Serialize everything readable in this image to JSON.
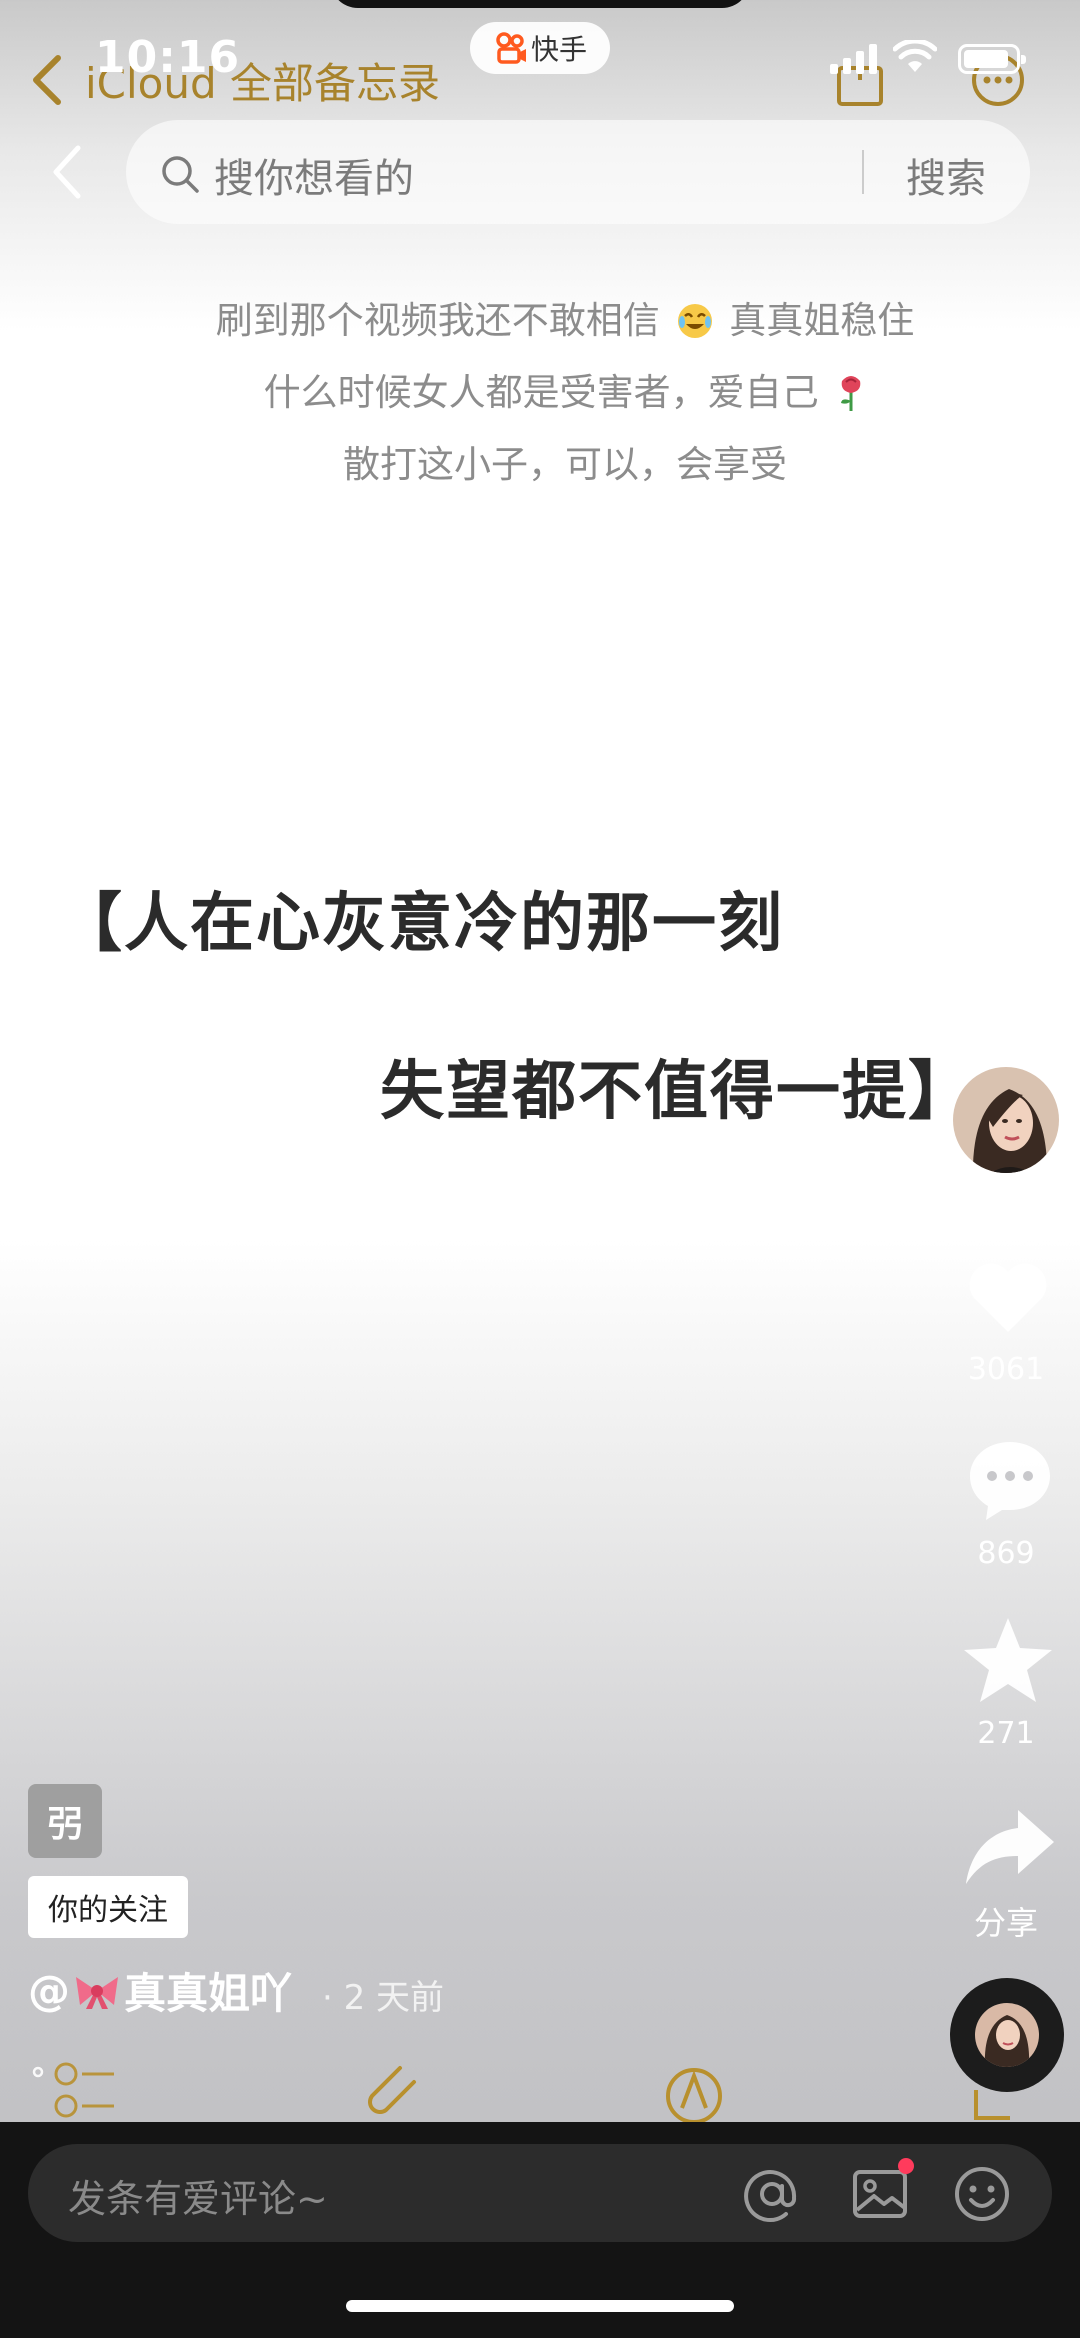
{
  "status_bar": {
    "time": "10:16"
  },
  "notes_app": {
    "back_label": "iCloud 全部备忘录"
  },
  "app_badge": {
    "name": "快手"
  },
  "search": {
    "placeholder": "搜你想看的",
    "button_label": "搜索"
  },
  "caption": {
    "line1_a": "刷到那个视频我还不敢相信",
    "line1_b": "真真姐稳住",
    "line2": "什么时候女人都是受害者，爱自己",
    "line3": "散打这小子，可以，会享受"
  },
  "quote": {
    "line1": "【人在心灰意冷的那一刻",
    "line2": "失望都不值得一提】"
  },
  "actions": {
    "like_count": "3061",
    "comment_count": "869",
    "favorite_count": "271",
    "share_label": "分享"
  },
  "info": {
    "label_badge": "弜",
    "follow_tag": "你的关注",
    "author_prefix": "@",
    "author_name": "真真姐吖",
    "post_time": "· 2 天前"
  },
  "comment_bar": {
    "placeholder": "发条有爱评论~"
  },
  "icons": {
    "back": "chevron-left-icon",
    "search": "search-icon",
    "like": "heart-icon",
    "comment": "comment-icon",
    "favorite": "star-icon",
    "share": "share-icon",
    "mention": "at-icon",
    "image": "image-icon",
    "emoji": "emoji-icon"
  },
  "colors": {
    "accent_notes": "#a8832c",
    "brand_kuaishou": "#ff5a1f",
    "notification_dot": "#ff3b5c"
  }
}
